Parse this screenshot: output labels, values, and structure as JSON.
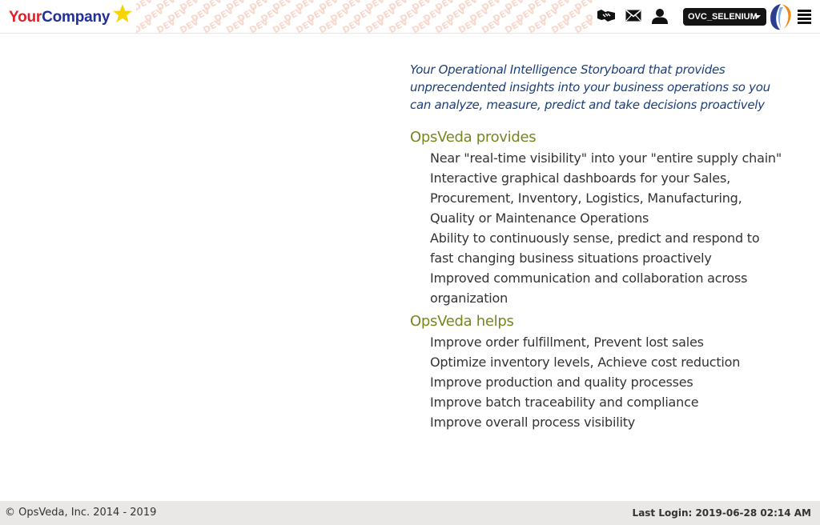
{
  "header": {
    "logo": {
      "part1": "Your",
      "part2": "Company"
    },
    "watermark_text": "DEV",
    "icons": [
      "handshake-icon",
      "mail-icon",
      "user-icon",
      "brand-logo-icon",
      "hamburger-menu-icon"
    ],
    "user_menu_label": "OVC_SELENIUM"
  },
  "main": {
    "tagline": "Your Operational Intelligence Storyboard that provides unprecendented insights into your business operations so you can analyze, measure, predict and take decisions proactively",
    "sections": [
      {
        "title": "OpsVeda provides",
        "items": [
          "Near \"real-time visibility\" into your \"entire supply chain\"",
          "Interactive graphical dashboards for your Sales, Procurement, Inventory, Logistics, Manufacturing, Quality or Maintenance Operations",
          "Ability to continuously sense, predict and respond to fast changing business situations proactively",
          "Improved communication and collaboration across organization"
        ]
      },
      {
        "title": "OpsVeda helps",
        "items": [
          "Improve order fulfillment, Prevent lost sales",
          "Optimize inventory levels, Achieve cost reduction",
          "Improve production and quality processes",
          "Improve batch traceability and compliance",
          "Improve overall process visibility"
        ]
      }
    ]
  },
  "footer": {
    "copyright": "© OpsVeda, Inc. 2014 - 2019",
    "last_login": "Last Login: 2019-06-28 02:14 AM"
  },
  "colors": {
    "tagline": "#1b3f7a",
    "section_title": "#7a8420",
    "logo_red": "#e0202a",
    "logo_blue": "#1f2f9c",
    "watermark": "#f7d8cc",
    "footer_bg": "#e9e8e6"
  }
}
